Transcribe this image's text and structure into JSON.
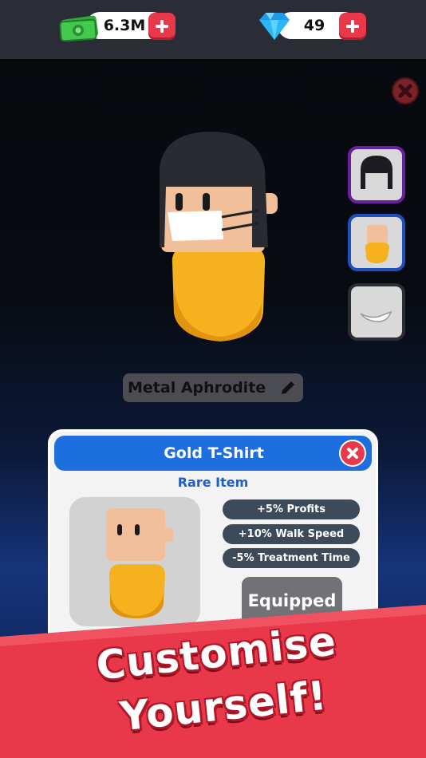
{
  "currency": {
    "cash_value": "6.3M",
    "gems_value": "49"
  },
  "avatar": {
    "name": "Metal Aphrodite"
  },
  "item_card": {
    "title": "Gold T-Shirt",
    "rarity": "Rare Item",
    "stats": [
      "+5% Profits",
      "+10% Walk Speed",
      "-5% Treatment Time"
    ],
    "equip_label": "Equipped"
  },
  "promo": {
    "line1": "Customise",
    "line2": "Yourself!"
  },
  "colors": {
    "accent_red": "#e8384a",
    "accent_blue": "#1d6fe0",
    "shirt_yellow": "#f5b21e",
    "slot_hair_border": "#6a1fa0",
    "slot_shirt_border": "#1d4fbf"
  },
  "icons": [
    "cash-icon",
    "gem-icon",
    "plus-icon",
    "close-icon",
    "pencil-icon",
    "hair-icon",
    "shirt-icon",
    "mask-icon"
  ]
}
